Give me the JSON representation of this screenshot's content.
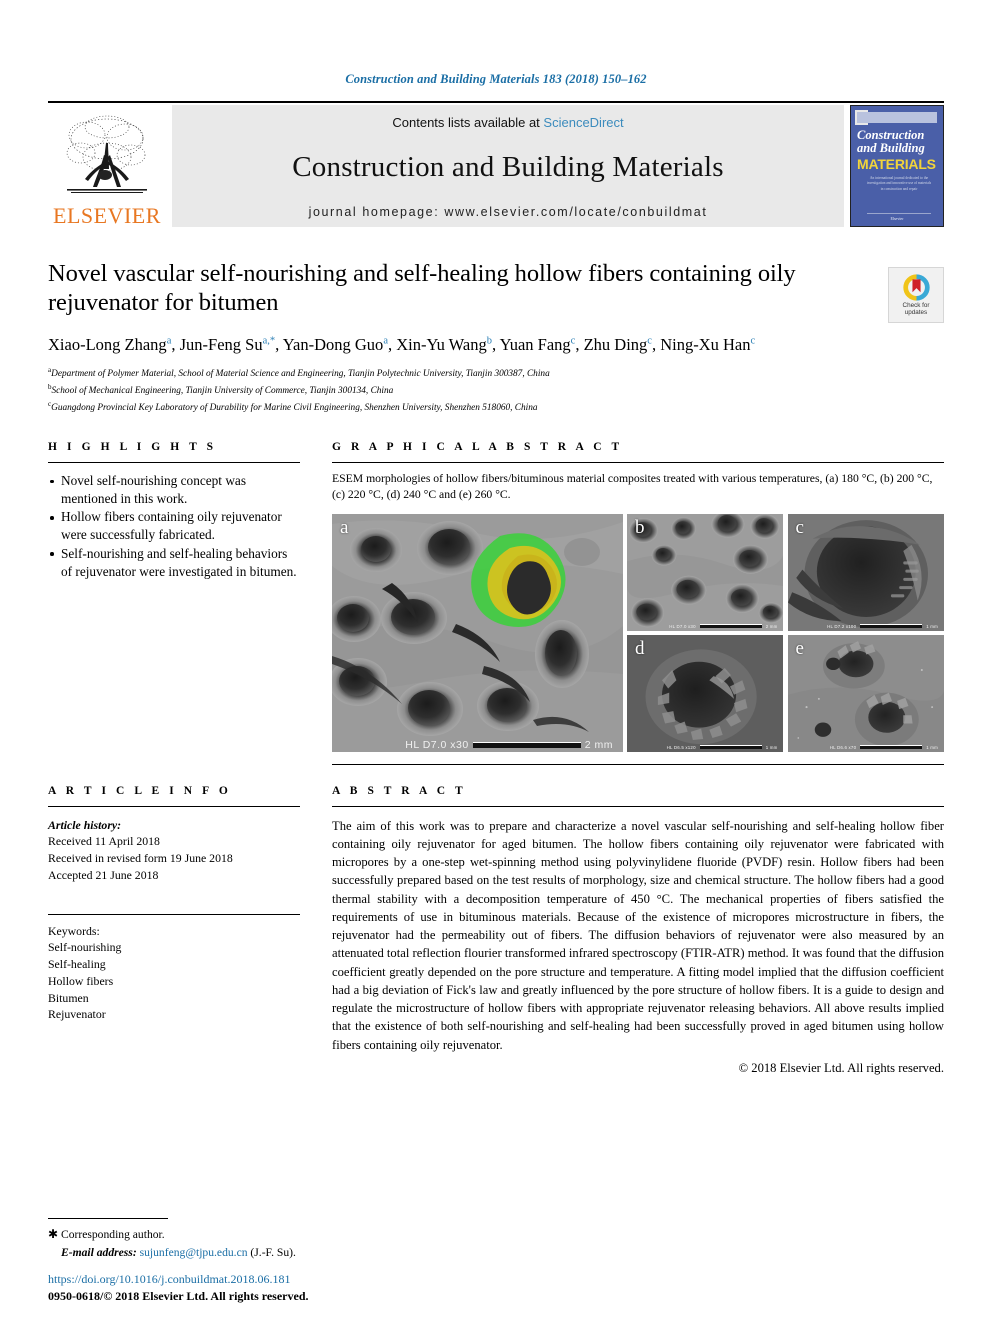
{
  "running_head": "Construction and Building Materials 183 (2018) 150–162",
  "masthead": {
    "publisher": "ELSEVIER",
    "contents_prefix": "Contents lists available at",
    "contents_link": "ScienceDirect",
    "journal_title": "Construction and Building Materials",
    "homepage": "journal homepage: www.elsevier.com/locate/conbuildmat",
    "cover": {
      "line1": "Construction",
      "line2": "and Building",
      "line3": "MATERIALS",
      "blurb": "An international journal dedicated to the investigation and innovative use of materials in construction and repair",
      "bottom": "Elsevier"
    }
  },
  "article": {
    "title": "Novel vascular self-nourishing and self-healing hollow fibers containing oily rejuvenator for bitumen",
    "authors_html": "Xiao-Long Zhang<sup>a</sup>, Jun-Feng Su<sup>a,*</sup>, Yan-Dong Guo<sup>a</sup>, Xin-Yu Wang<sup>b</sup>, Yuan Fang<sup>c</sup>, Zhu Ding<sup>c</sup>, Ning-Xu Han<sup>c</sup>",
    "affiliations": [
      {
        "mark": "a",
        "text": "Department of Polymer Material, School of Material Science and Engineering, Tianjin Polytechnic University, Tianjin 300387, China"
      },
      {
        "mark": "b",
        "text": "School of Mechanical Engineering, Tianjin University of Commerce, Tianjin 300134, China"
      },
      {
        "mark": "c",
        "text": "Guangdong Provincial Key Laboratory of Durability for Marine Civil Engineering, Shenzhen University, Shenzhen 518060, China"
      }
    ],
    "crossmark_label": "Check for\nupdates"
  },
  "highlights": {
    "heading": "H I G H L I G H T S",
    "items": [
      "Novel self-nourishing concept was mentioned in this work.",
      "Hollow fibers containing oily rejuvenator were successfully fabricated.",
      "Self-nourishing and self-healing behaviors of rejuvenator were investigated in bitumen."
    ]
  },
  "graphical_abstract": {
    "heading": "G R A P H I C A L   A B S T R A C T",
    "caption": "ESEM morphologies of hollow fibers/bituminous material composites treated with various temperatures, (a) 180 °C, (b) 200 °C, (c) 220 °C, (d) 240 °C and (e) 260 °C.",
    "panels": [
      {
        "label": "a",
        "scale_meta": "HL  D7.0  x30",
        "scale_value": "2 mm"
      },
      {
        "label": "b",
        "scale_meta": "HL  D7.0  x30",
        "scale_value": "2 mm"
      },
      {
        "label": "c",
        "scale_meta": "HL  D7.2  x100",
        "scale_value": "1 mm"
      },
      {
        "label": "d",
        "scale_meta": "HL  D6.5  x120",
        "scale_value": "1 mm"
      },
      {
        "label": "e",
        "scale_meta": "HL  D6.6  x70",
        "scale_value": "1 mm"
      }
    ]
  },
  "article_info": {
    "heading": "A R T I C L E   I N F O",
    "history_label": "Article history:",
    "history": [
      "Received 11 April 2018",
      "Received in revised form 19 June 2018",
      "Accepted 21 June 2018"
    ],
    "keywords_label": "Keywords:",
    "keywords": [
      "Self-nourishing",
      "Self-healing",
      "Hollow fibers",
      "Bitumen",
      "Rejuvenator"
    ]
  },
  "abstract": {
    "heading": "A B S T R A C T",
    "text": "The aim of this work was to prepare and characterize a novel vascular self-nourishing and self-healing hollow fiber containing oily rejuvenator for aged bitumen. The hollow fibers containing oily rejuvenator were fabricated with micropores by a one-step wet-spinning method using polyvinylidene fluoride (PVDF) resin. Hollow fibers had been successfully prepared based on the test results of morphology, size and chemical structure. The hollow fibers had a good thermal stability with a decomposition temperature of 450 °C. The mechanical properties of fibers satisfied the requirements of use in bituminous materials. Because of the existence of micropores microstructure in fibers, the rejuvenator had the permeability out of fibers. The diffusion behaviors of rejuvenator were also measured by an attenuated total reflection flourier transformed infrared spectroscopy (FTIR-ATR) method. It was found that the diffusion coefficient greatly depended on the pore structure and temperature. A fitting model implied that the diffusion coefficient had a big deviation of Fick's law and greatly influenced by the pore structure of hollow fibers. It is a guide to design and regulate the microstructure of hollow fibers with appropriate rejuvenator releasing behaviors. All above results implied that the existence of both self-nourishing and self-healing had been successfully proved in aged bitumen using hollow fibers containing oily rejuvenator.",
    "copyright": "© 2018 Elsevier Ltd. All rights reserved."
  },
  "footer": {
    "corresponding_author": "Corresponding author.",
    "email_label": "E-mail address:",
    "email": "sujunfeng@tjpu.edu.cn",
    "email_suffix": "(J.-F. Su).",
    "doi": "https://doi.org/10.1016/j.conbuildmat.2018.06.181",
    "issn_line": "0950-0618/© 2018 Elsevier Ltd. All rights reserved."
  }
}
